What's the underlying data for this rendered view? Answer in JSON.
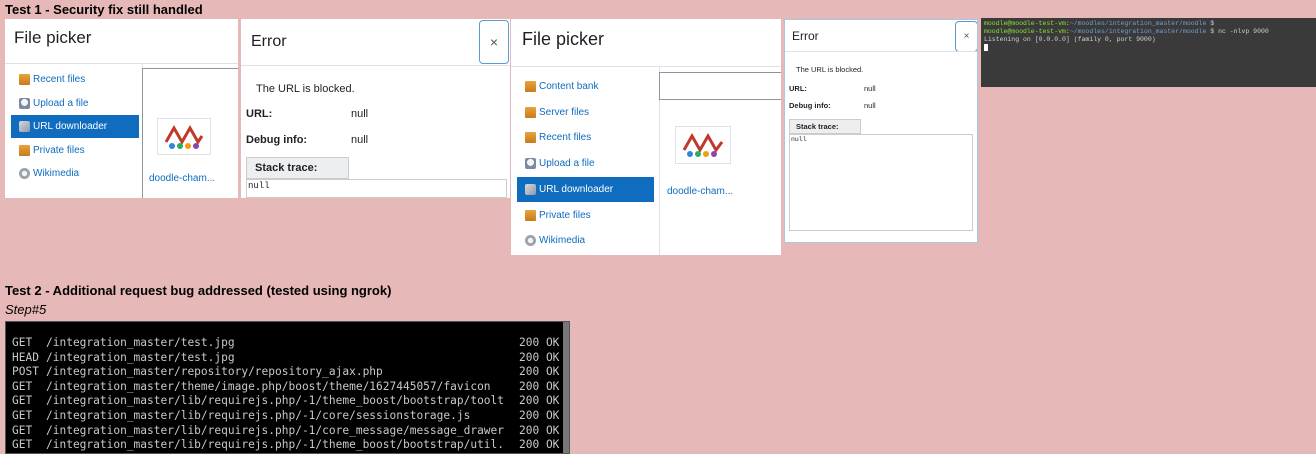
{
  "section1": {
    "heading": "Test 1 - Security fix still handled"
  },
  "section2": {
    "heading": "Test 2 - Additional request bug addressed (tested using ngrok)",
    "step": "Step#5"
  },
  "filepicker_small": {
    "title": "File picker",
    "items": [
      {
        "label": "Recent files",
        "icon": "folder-icon",
        "active": false
      },
      {
        "label": "Upload a file",
        "icon": "upload-icon",
        "active": false
      },
      {
        "label": "URL downloader",
        "icon": "url-downloader-icon",
        "active": true
      },
      {
        "label": "Private files",
        "icon": "folder-icon",
        "active": false
      },
      {
        "label": "Wikimedia",
        "icon": "wikimedia-icon",
        "active": false
      }
    ],
    "file_name": "doodle-cham..."
  },
  "error_small": {
    "title": "Error",
    "close": "×",
    "message": "The URL is blocked.",
    "url_label": "URL:",
    "url_value": "null",
    "debug_label": "Debug info:",
    "debug_value": "null",
    "stack_label": "Stack trace:",
    "stack_value": "null"
  },
  "filepicker_large": {
    "title": "File picker",
    "items": [
      {
        "label": "Content bank",
        "icon": "folder-icon",
        "active": false
      },
      {
        "label": "Server files",
        "icon": "folder-icon",
        "active": false
      },
      {
        "label": "Recent files",
        "icon": "folder-icon",
        "active": false
      },
      {
        "label": "Upload a file",
        "icon": "upload-icon",
        "active": false
      },
      {
        "label": "URL downloader",
        "icon": "url-downloader-icon",
        "active": true
      },
      {
        "label": "Private files",
        "icon": "folder-icon",
        "active": false
      },
      {
        "label": "Wikimedia",
        "icon": "wikimedia-icon",
        "active": false
      }
    ],
    "file_name": "doodle-cham..."
  },
  "error_large": {
    "title": "Error",
    "close": "×",
    "message": "The URL is blocked.",
    "url_label": "URL:",
    "url_value": "null",
    "debug_label": "Debug info:",
    "debug_value": "null",
    "stack_label": "Stack trace:",
    "stack_value": "null"
  },
  "terminal1": {
    "lines": [
      {
        "user": "moodle@moodle-test-vm",
        "path": "~/moodles/integration_master/moodle",
        "cmd": "$"
      },
      {
        "user": "moodle@moodle-test-vm",
        "path": "~/moodles/integration_master/moodle",
        "cmd": "$ nc -nlvp 9000"
      }
    ],
    "output": "Listening on [0.0.0.0] (family 0, port 9000)"
  },
  "terminal2": {
    "requests": [
      {
        "method": "GET",
        "path": "/integration_master/test.jpg",
        "status": "200 OK"
      },
      {
        "method": "HEAD",
        "path": "/integration_master/test.jpg",
        "status": "200 OK"
      },
      {
        "method": "POST",
        "path": "/integration_master/repository/repository_ajax.php",
        "status": "200 OK"
      },
      {
        "method": "GET",
        "path": "/integration_master/theme/image.php/boost/theme/1627445057/favicon",
        "status": "200 OK"
      },
      {
        "method": "GET",
        "path": "/integration_master/lib/requirejs.php/-1/theme_boost/bootstrap/toolt",
        "status": "200 OK"
      },
      {
        "method": "GET",
        "path": "/integration_master/lib/requirejs.php/-1/core/sessionstorage.js",
        "status": "200 OK"
      },
      {
        "method": "GET",
        "path": "/integration_master/lib/requirejs.php/-1/core_message/message_drawer",
        "status": "200 OK"
      },
      {
        "method": "GET",
        "path": "/integration_master/lib/requirejs.php/-1/theme_boost/bootstrap/util.",
        "status": "200 OK"
      }
    ]
  }
}
